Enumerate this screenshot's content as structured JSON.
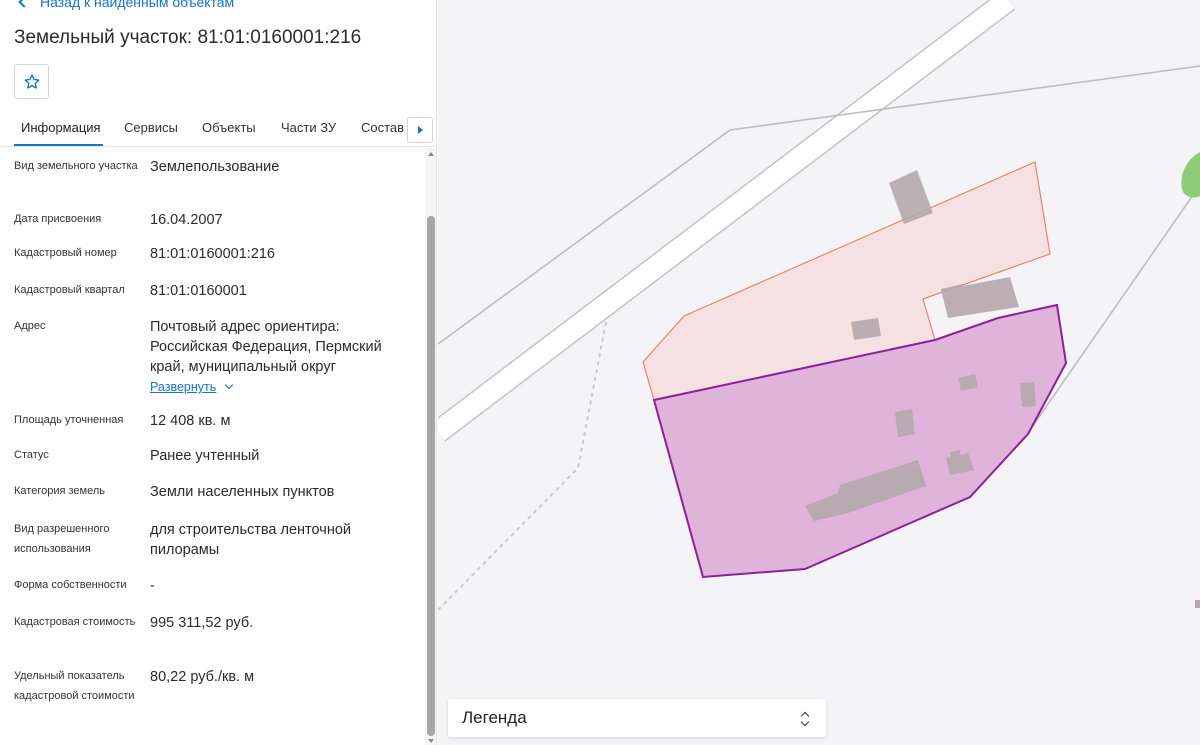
{
  "back_link": {
    "label": "Назад к найденным объектам"
  },
  "title": "Земельный участок: 81:01:0160001:216",
  "favorite": {
    "icon": "star-icon"
  },
  "tabs": [
    {
      "label": "Информация",
      "active": true
    },
    {
      "label": "Сервисы"
    },
    {
      "label": "Объекты"
    },
    {
      "label": "Части ЗУ"
    },
    {
      "label": "Состав"
    }
  ],
  "tabs_next_icon": "arrow-right-icon",
  "fields": [
    {
      "label": "Вид земельного участка",
      "value": "Землепользование"
    },
    {
      "label": "Дата присвоения",
      "value": "16.04.2007"
    },
    {
      "label": "Кадастровый номер",
      "value": "81:01:0160001:216"
    },
    {
      "label": "Кадастровый квартал",
      "value": "81:01:0160001"
    },
    {
      "label": "Адрес",
      "value": "Почтовый адрес ориентира: Российская Федерация, Пермский край, муниципальный округ",
      "expand_label": "Развернуть"
    },
    {
      "label": "Площадь уточненная",
      "value": "12 408 кв. м"
    },
    {
      "label": "Статус",
      "value": "Ранее учтенный"
    },
    {
      "label": "Категория земель",
      "value": "Земли населенных пунктов"
    },
    {
      "label": "Вид разрешенного использования",
      "value": "для строительства ленточной пилорамы"
    },
    {
      "label": "Форма собственности",
      "value": "-"
    },
    {
      "label": "Кадастровая стоимость",
      "value": "995 311,52 руб."
    },
    {
      "label": "Удельный показатель кадастровой стоимости",
      "value": "80,22 руб./кв. м"
    }
  ],
  "legend": {
    "label": "Легенда",
    "icon": "sort-toggle-icon"
  },
  "colors": {
    "accent": "#1a73c8",
    "selected_parcel_fill": "#dfb3da",
    "selected_parcel_stroke": "#8e1f99",
    "neighbor_parcel_fill": "#f5e1e1",
    "neighbor_parcel_stroke": "#e8846f",
    "building": "#b9aeb2",
    "map_background": "#f4f4f6"
  }
}
